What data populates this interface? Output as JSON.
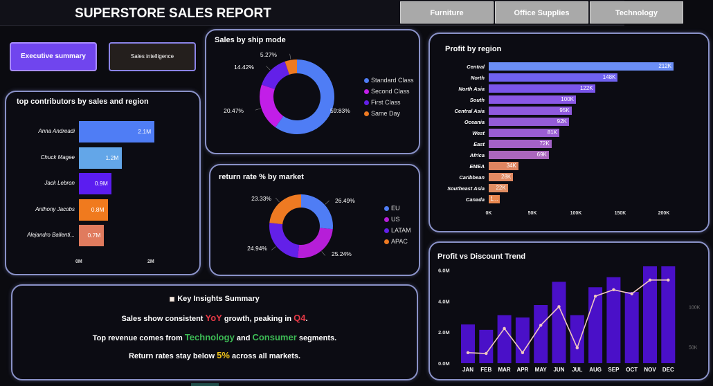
{
  "header": {
    "title": "SUPERSTORE SALES REPORT",
    "tabs": [
      "Furniture",
      "Office Supplies",
      "Technology"
    ]
  },
  "nav": {
    "exec_label": "Executive summary",
    "sales_label": "Sales intelligence"
  },
  "contributors": {
    "title": "top contributors by sales and region",
    "x_ticks": [
      "0M",
      "2M"
    ],
    "chart_data": {
      "type": "bar",
      "orientation": "horizontal",
      "categories": [
        "Anna Andreadi",
        "Chuck Magee",
        "Jack Lebron",
        "Anthony Jacobs",
        "Alejandro Ballenti..."
      ],
      "values": [
        2.1,
        1.2,
        0.9,
        0.8,
        0.7
      ],
      "labels": [
        "2.1M",
        "1.2M",
        "0.9M",
        "0.8M",
        "0.7M"
      ],
      "colors": [
        "#4f7df5",
        "#63a6e8",
        "#5b1df0",
        "#f07a1e",
        "#e07b5e"
      ],
      "xlim": [
        0,
        2.2
      ]
    }
  },
  "ship": {
    "title": "Sales by ship mode",
    "chart_data": {
      "type": "pie",
      "donut": true,
      "categories": [
        "Standard Class",
        "Second Class",
        "First Class",
        "Same Day"
      ],
      "values": [
        59.83,
        20.47,
        14.42,
        5.27
      ],
      "labels": [
        "59.83%",
        "20.47%",
        "14.42%",
        "5.27%"
      ],
      "colors": [
        "#4f7df5",
        "#c21ee8",
        "#6320e8",
        "#ee7a22"
      ],
      "legend": "right"
    }
  },
  "returns": {
    "title": "return rate % by market",
    "chart_data": {
      "type": "pie",
      "donut": true,
      "categories": [
        "EU",
        "US",
        "LATAM",
        "APAC"
      ],
      "values": [
        26.49,
        25.24,
        24.94,
        23.33
      ],
      "labels": [
        "26.49%",
        "25.24%",
        "24.94%",
        "23.33%"
      ],
      "colors": [
        "#4f7df5",
        "#b61ed8",
        "#6320e8",
        "#ee7a22"
      ],
      "legend": "right"
    }
  },
  "region": {
    "title": "Profit by region",
    "x_ticks": [
      "0K",
      "50K",
      "100K",
      "150K",
      "200K"
    ],
    "chart_data": {
      "type": "bar",
      "orientation": "horizontal",
      "categories": [
        "Central",
        "North",
        "North Asia",
        "South",
        "Central Asia",
        "Oceania",
        "West",
        "East",
        "Africa",
        "EMEA",
        "Caribbean",
        "Southeast Asia",
        "Canada"
      ],
      "values": [
        212,
        148,
        122,
        100,
        95,
        92,
        81,
        72,
        69,
        34,
        28,
        22,
        13
      ],
      "labels": [
        "212K",
        "148K",
        "122K",
        "100K",
        "95K",
        "92K",
        "81K",
        "72K",
        "69K",
        "34K",
        "28K",
        "22K",
        "1..."
      ],
      "colors": [
        "#6b8ef5",
        "#6f62f0",
        "#7a55ea",
        "#8a58e6",
        "#8f5ade",
        "#945cd8",
        "#9a5dd2",
        "#a462c8",
        "#ab66bd",
        "#de8460",
        "#e18a63",
        "#e08d62",
        "#ea8850"
      ],
      "xlim": [
        0,
        212
      ]
    }
  },
  "insights": {
    "icon": "note-icon",
    "heading": "Key Insights Summary",
    "line1": {
      "a": "Sales show consistent ",
      "b": "YoY",
      "c": " growth, peaking in ",
      "d": "Q4",
      "e": "."
    },
    "line2": {
      "a": "Top revenue comes from ",
      "b": "Technology",
      "c": " and ",
      "d": "Consumer",
      "e": " segments."
    },
    "line3": {
      "a": "Return rates stay below ",
      "b": "5%",
      "c": " across all markets."
    }
  },
  "trend": {
    "title": "Profit vs Discount Trend",
    "y_ticks": [
      "6.0M",
      "4.0M",
      "2.0M",
      "0.0M"
    ],
    "y2_ticks": [
      "100K",
      "50K"
    ],
    "chart_data": {
      "type": "bar",
      "categories": [
        "JAN",
        "FEB",
        "MAR",
        "APR",
        "MAY",
        "JUN",
        "JUL",
        "AUG",
        "SEP",
        "OCT",
        "NOV",
        "DEC"
      ],
      "series": [
        {
          "kind": "bar",
          "axis": "left",
          "values": [
            2.5,
            2.15,
            3.1,
            2.95,
            3.75,
            5.25,
            3.1,
            4.9,
            5.55,
            4.6,
            6.25,
            6.25
          ]
        },
        {
          "kind": "line",
          "axis": "right",
          "values": [
            43,
            42,
            73,
            43,
            77,
            100,
            49,
            113,
            121,
            116,
            133,
            133
          ]
        }
      ],
      "ylim": [
        0,
        6.25
      ],
      "y2lim": [
        30,
        150
      ],
      "colors": {
        "bar": "#4a10c8",
        "line": "#f0c8c0"
      }
    }
  }
}
